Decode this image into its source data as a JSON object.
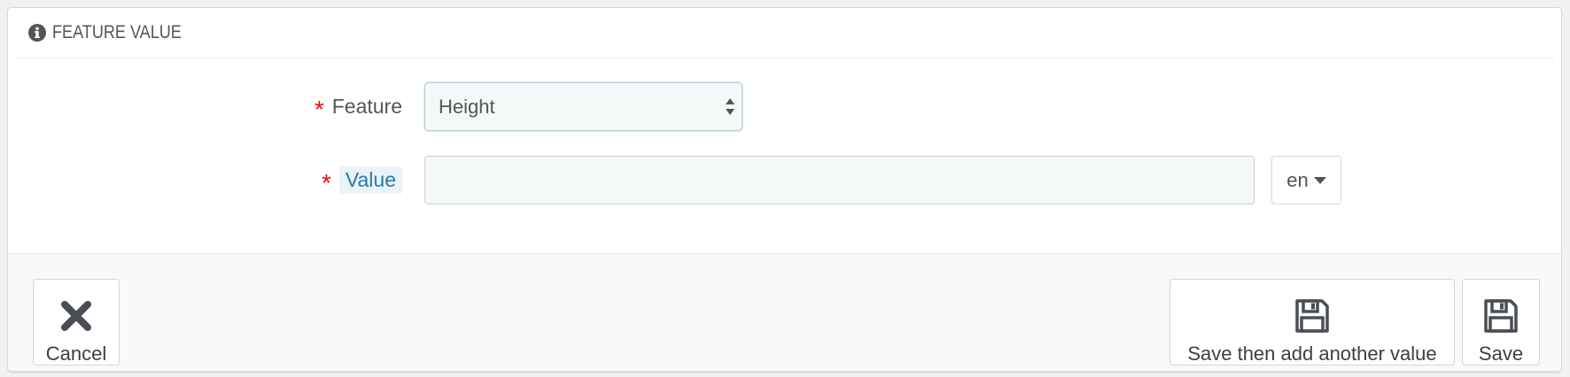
{
  "panel": {
    "title": "FEATURE VALUE",
    "icon": "info-circle-icon"
  },
  "form": {
    "feature": {
      "required_mark": "*",
      "label": "Feature",
      "selected": "Height"
    },
    "value": {
      "required_mark": "*",
      "label": "Value",
      "input_value": "",
      "language": "en"
    }
  },
  "footer": {
    "cancel_label": "Cancel",
    "cancel_icon": "close-icon",
    "save_add_label": "Save then add another value",
    "save_add_icon": "floppy-disk-icon",
    "save_label": "Save",
    "save_icon": "floppy-disk-icon"
  },
  "colors": {
    "required": "#e50b0b",
    "hint_label": "#2a7ba8",
    "text": "#555555"
  }
}
